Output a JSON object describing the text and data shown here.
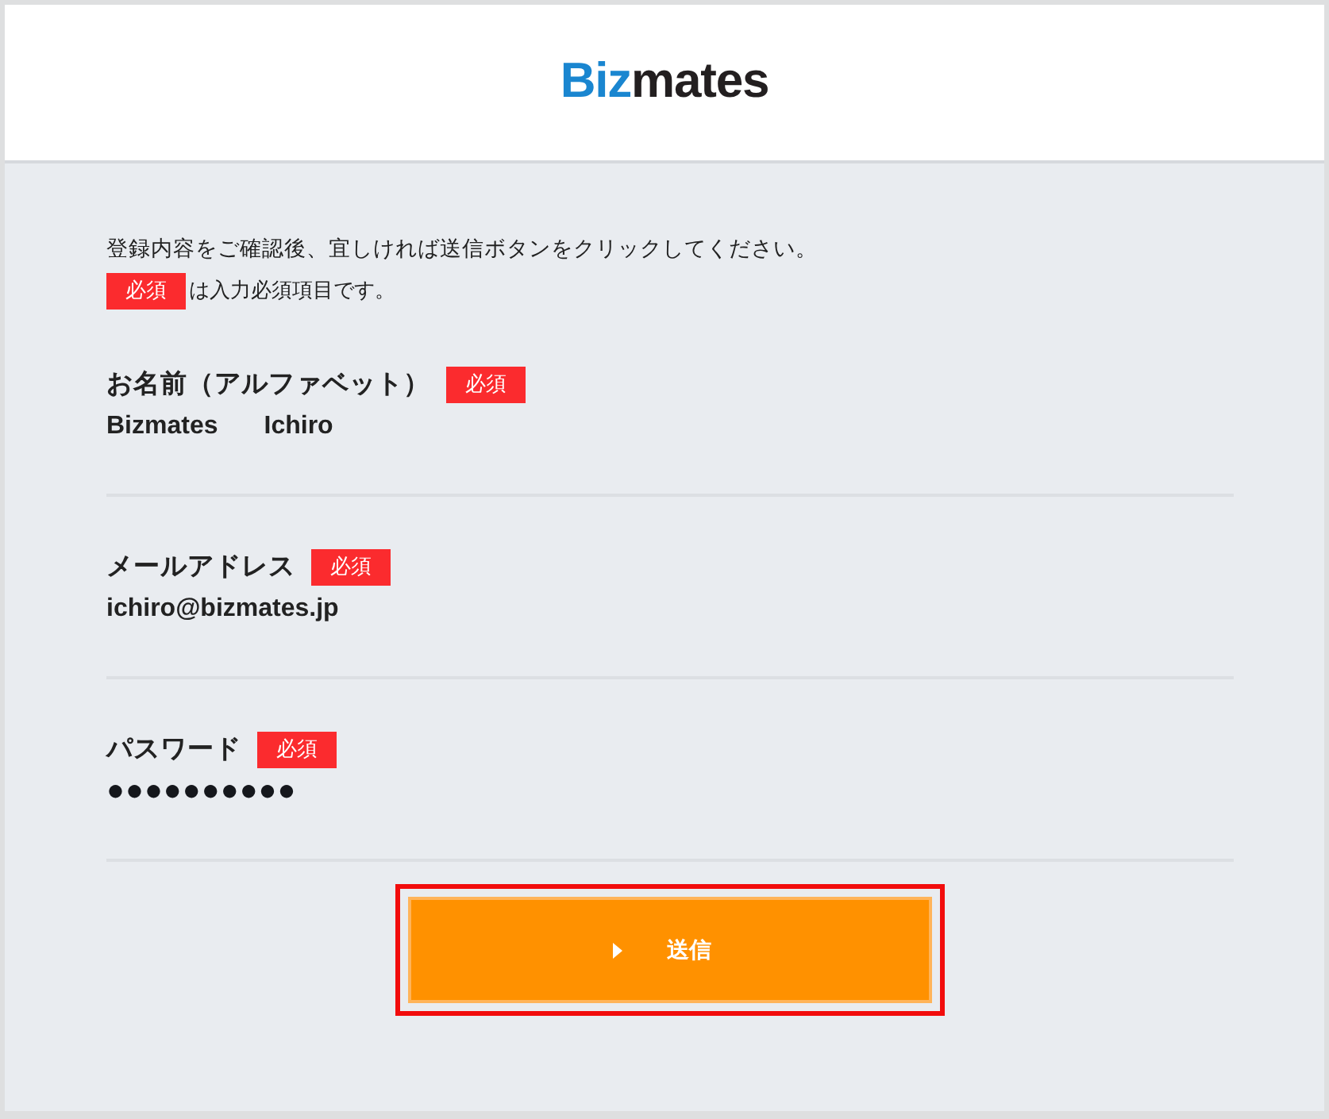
{
  "header": {
    "logo": {
      "parts": [
        {
          "text": "Biz",
          "color": "#1a86d0"
        },
        {
          "text": "mates",
          "color": "#231f20"
        }
      ]
    }
  },
  "intro": {
    "text": "登録内容をご確認後、宜しければ送信ボタンをクリックしてください。",
    "legend": {
      "badge": "必須",
      "text": "は入力必須項目です。"
    }
  },
  "fields": [
    {
      "kind": "text",
      "label": "お名前（アルファベット）",
      "required": true,
      "badge": "必須",
      "values": [
        "Bizmates",
        "Ichiro"
      ]
    },
    {
      "kind": "text",
      "label": "メールアドレス",
      "required": true,
      "badge": "必須",
      "values": [
        "ichiro@bizmates.jp"
      ]
    },
    {
      "kind": "password",
      "label": "パスワード",
      "required": true,
      "badge": "必須",
      "values": [
        "●●●●●●●●●●"
      ]
    }
  ],
  "submit": {
    "label": "送信",
    "highlighted": true
  }
}
